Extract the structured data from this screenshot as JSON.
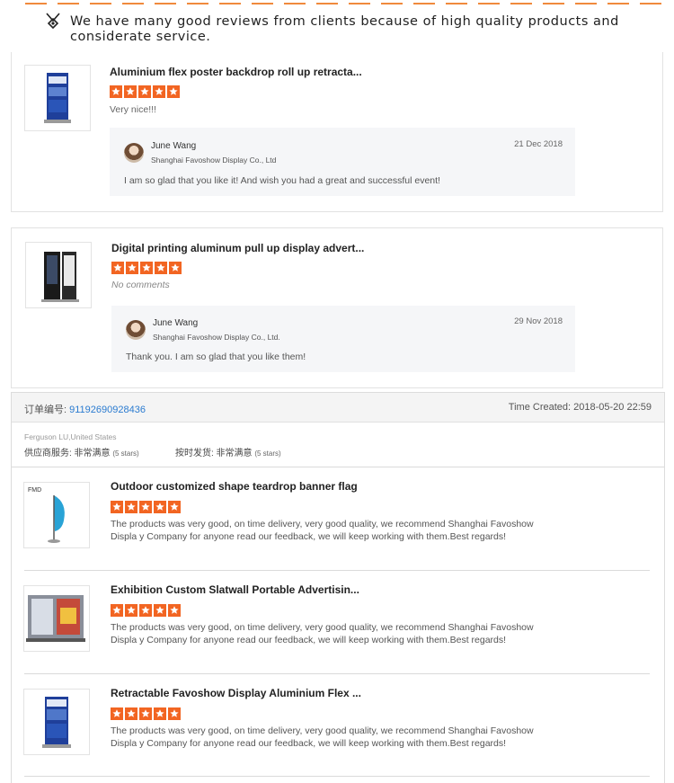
{
  "header": {
    "text": "We have many good reviews from clients because of high quality products and considerate service.",
    "icon": "medal-icon",
    "dash_color": "#f08a3c"
  },
  "reviews": [
    {
      "product_title": "Aluminium flex poster backdrop roll up retracta...",
      "rating": 5,
      "comment": "Very nice!!!",
      "reply": {
        "name": "June Wang",
        "company": "Shanghai Favoshow Display Co., Ltd",
        "date": "21 Dec 2018",
        "text": "I am so glad that you like it! And wish you had a great and successful event!"
      }
    },
    {
      "product_title": "Digital printing aluminum pull up display advert...",
      "rating": 5,
      "comment": "No comments",
      "reply": {
        "name": "June Wang",
        "company": "Shanghai Favoshow Display Co., Ltd.",
        "date": "29 Nov 2018",
        "text": "Thank you. I am so glad that you like them!"
      }
    }
  ],
  "order": {
    "label": "订单编号:",
    "number": "91192690928436",
    "time_created": "Time Created: 2018-05-20 22:59",
    "buyer": "Ferguson LU,United States",
    "rating1_label": "供应商服务: 非常满意",
    "rating1_stars": "(5 stars)",
    "rating2_label": "按时发货: 非常满意",
    "rating2_stars": "(5 stars)",
    "items": [
      {
        "title": "Outdoor customized shape teardrop banner flag",
        "rating": 5,
        "text": "The products was very good, on time delivery, very good quality, we recommend Shanghai Favoshow Displa y Company for anyone read our feedback, we will keep working with them.Best regards!"
      },
      {
        "title": "Exhibition Custom Slatwall Portable Advertisin...",
        "rating": 5,
        "text": "The products was very good, on time delivery, very good quality, we recommend Shanghai Favoshow Displa y Company for anyone read our feedback, we will keep working with them.Best regards!"
      },
      {
        "title": "Retractable Favoshow Display Aluminium Flex ...",
        "rating": 5,
        "text": "The products was very good, on time delivery, very good quality, we recommend Shanghai Favoshow Displa y Company for anyone read our feedback, we will keep working with them.Best regards!"
      }
    ]
  },
  "colors": {
    "star": "#f26522",
    "order_number": "#2a7bd0"
  }
}
